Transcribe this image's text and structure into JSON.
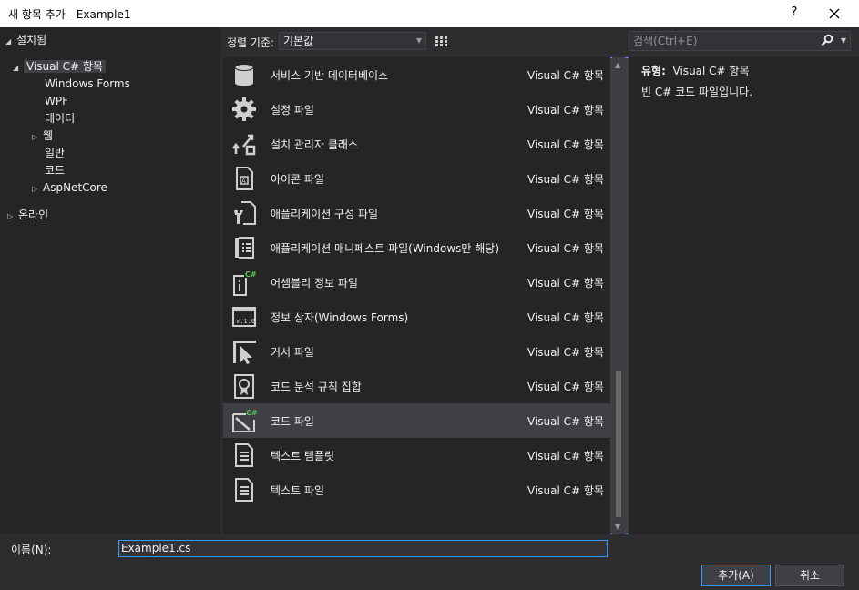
{
  "window": {
    "title": "새 항목 추가 - Example1",
    "help": "?"
  },
  "tree": {
    "installed": "설치됨",
    "visual_cs": "Visual C# 항목",
    "windows_forms": "Windows Forms",
    "wpf": "WPF",
    "data": "데이터",
    "web": "웹",
    "general": "일반",
    "code": "코드",
    "aspnetcore": "AspNetCore",
    "online": "온라인"
  },
  "toolbar": {
    "sort_label": "정렬 기준:",
    "sort_value": "기본값",
    "search_placeholder": "검색(Ctrl+E)"
  },
  "templates": [
    {
      "name": "서비스 기반 데이터베이스",
      "type": "Visual C# 항목",
      "icon": "database-icon"
    },
    {
      "name": "설정 파일",
      "type": "Visual C# 항목",
      "icon": "gear-icon"
    },
    {
      "name": "설치 관리자 클래스",
      "type": "Visual C# 항목",
      "icon": "installer-icon"
    },
    {
      "name": "아이콘 파일",
      "type": "Visual C# 항목",
      "icon": "icon-file-icon"
    },
    {
      "name": "애플리케이션 구성 파일",
      "type": "Visual C# 항목",
      "icon": "config-file-icon"
    },
    {
      "name": "애플리케이션 매니페스트 파일(Windows만 해당)",
      "type": "Visual C# 항목",
      "icon": "manifest-icon"
    },
    {
      "name": "어셈블리 정보 파일",
      "type": "Visual C# 항목",
      "icon": "assembly-info-icon"
    },
    {
      "name": "정보 상자(Windows Forms)",
      "type": "Visual C# 항목",
      "icon": "about-box-icon"
    },
    {
      "name": "커서 파일",
      "type": "Visual C# 항목",
      "icon": "cursor-icon"
    },
    {
      "name": "코드 분석 규칙 집합",
      "type": "Visual C# 항목",
      "icon": "ruleset-icon"
    },
    {
      "name": "코드 파일",
      "type": "Visual C# 항목",
      "icon": "code-file-icon"
    },
    {
      "name": "텍스트 템플릿",
      "type": "Visual C# 항목",
      "icon": "text-template-icon"
    },
    {
      "name": "텍스트 파일",
      "type": "Visual C# 항목",
      "icon": "text-file-icon"
    }
  ],
  "info": {
    "type_label": "유형:",
    "type_value": "Visual C# 항목",
    "description": "빈 C# 코드 파일입니다."
  },
  "bottom": {
    "name_label": "이름(N):",
    "name_value": "Example1.cs",
    "add_label": "추가(A)",
    "cancel_label": "취소"
  },
  "colors": {
    "accent": "#3399ff",
    "background": "#2d2d30",
    "panel": "#252526",
    "selected": "#3f3f46"
  }
}
